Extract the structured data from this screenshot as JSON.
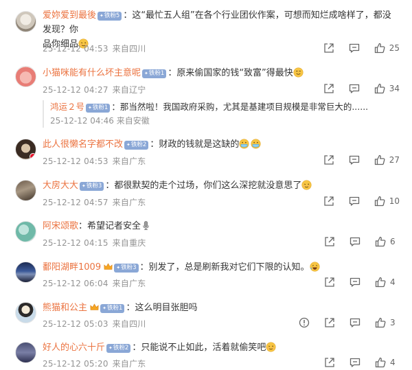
{
  "comments": [
    {
      "user": "爱妳爱到最後",
      "badge": "铁粉5",
      "text_line1": "：这“最忙五人组”在各个行业团伙作案，可想而知烂成啥样了，都没发现？你",
      "text_line2": "品你细品",
      "date": "25-12-12 04:53",
      "location": "来自四川",
      "likes": "25"
    },
    {
      "user": "小猫咪能有什么坏主意呢",
      "badge": "铁粉1",
      "text_line1": "：原来偷国家的钱“致富”得最快",
      "date": "25-12-12 04:27",
      "location": "来自辽宁",
      "likes": "34",
      "reply": {
        "user": "鸿运２号",
        "badge": "铁粉1",
        "text": "：那当然啦！我国政府采购，尤其是基建项目规模是非常巨大的......",
        "date": "25-12-12 04:46",
        "location": "来自安徽"
      }
    },
    {
      "user": "此人很懒名字都不改",
      "badge": "铁粉2",
      "text_line1": "：财政的钱就是这缺的",
      "date": "25-12-12 04:53",
      "location": "来自广东",
      "likes": "27"
    },
    {
      "user": "大房大大",
      "badge": "铁粉3",
      "text_line1": "：都很默契的走个过场，你们这么深挖就没意思了",
      "date": "25-12-12 04:57",
      "location": "来自广东",
      "likes": "10"
    },
    {
      "user": "阿宋颂歌",
      "text_line1": "：希望记者安全",
      "date": "25-12-12 04:15",
      "location": "来自重庆",
      "likes": "6"
    },
    {
      "user": "鄱阳湖畔1009",
      "badge": "铁粉3",
      "text_line1": "：别发了，总是刷新我对它们下限的认知。",
      "date": "25-12-12 06:04",
      "location": "来自广东",
      "likes": "4"
    },
    {
      "user": "熊猫和公主",
      "badge": "铁粉1",
      "text_line1": "：这么明目张胆吗",
      "date": "25-12-12 05:03",
      "location": "来自四川",
      "likes": "3"
    },
    {
      "user": "好人的心六十斤",
      "badge": "铁粉2",
      "text_line1": "：只能说不止如此，活着就偷笑吧",
      "date": "25-12-12 05:20",
      "location": "来自广东",
      "likes": "4"
    }
  ],
  "icons": {
    "share": "share-icon",
    "comment": "comment-icon",
    "like": "thumbs-up-icon",
    "report": "report-icon",
    "emoji_wink": "wink-emoji-icon",
    "emoji_smile": "smile-emoji-icon",
    "emoji_mask": "mask-emoji-icon",
    "emoji_mic": "microphone-emoji-icon",
    "emoji_laugh": "laugh-emoji-icon"
  },
  "colors": {
    "username": "#eb7340",
    "badge": "#8aa7d6",
    "meta": "#939393",
    "text": "#333333"
  }
}
